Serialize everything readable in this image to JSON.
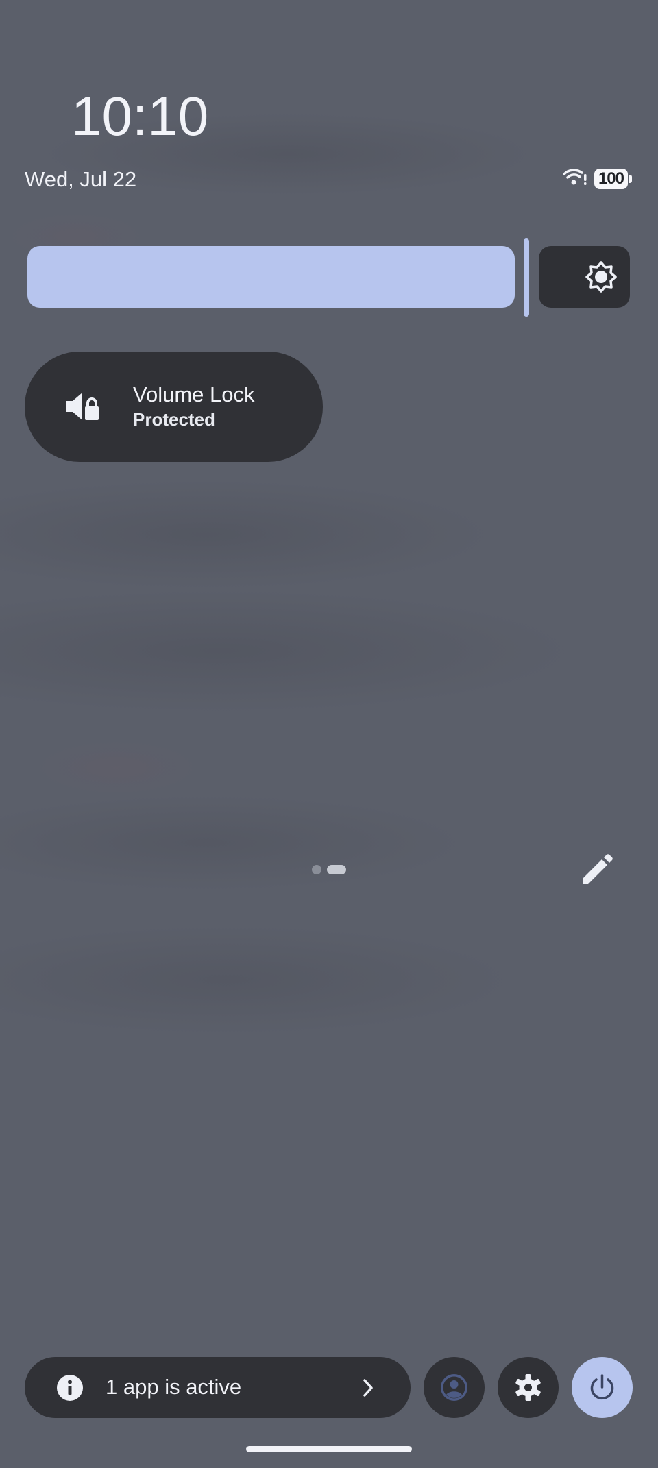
{
  "status_bar": {
    "time": "10:10",
    "date": "Wed, Jul 22",
    "wifi_icon": "wifi-alert-icon",
    "battery_level": "100"
  },
  "brightness": {
    "level_fraction": 0.88,
    "icon": "brightness-icon",
    "accent_color": "#b7c5ee"
  },
  "tiles": [
    {
      "title": "Volume Lock",
      "subtitle": "Protected",
      "icon": "volume-lock-icon"
    }
  ],
  "pager": {
    "page_count": 2,
    "current_page": 2
  },
  "footer": {
    "active_apps_label": "1 app is active",
    "info_icon": "info-icon",
    "chevron_icon": "chevron-right-icon",
    "user_icon": "user-icon",
    "settings_icon": "gear-icon",
    "power_icon": "power-icon"
  }
}
